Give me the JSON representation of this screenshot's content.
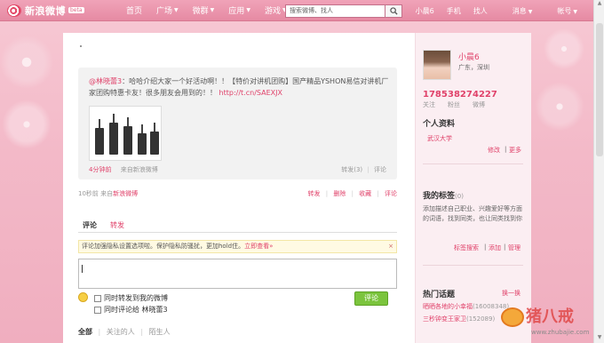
{
  "topnav": {
    "logo_text": "新浪微博",
    "logo_badge": "beta",
    "items": [
      "首页",
      "广场",
      "微群",
      "应用",
      "游戏"
    ],
    "search_placeholder": "搜索微博、找人",
    "right_items": [
      "小晨6",
      "手机",
      "找人",
      "消息",
      "帐号"
    ]
  },
  "feed": {
    "author": "@林晓蕾3",
    "text": "：哈哈介绍大家一个好活动啊！！【特价对讲机团购】国产精品YSHON易信对讲机厂家团购特惠卡友！很多朋友会用到的！！",
    "link": "http://t.cn/SAEXJX",
    "time": "4分钟前",
    "source": "来自新浪微博",
    "forward": "转发(3)",
    "comment": "评论"
  },
  "status": {
    "time": "10秒前",
    "source_prefix": "来自",
    "source": "新浪微博",
    "actions": [
      "转发",
      "删除",
      "收藏",
      "评论"
    ]
  },
  "tabs": {
    "comment": "评论",
    "forward": "转发"
  },
  "notice": {
    "text": "评论加强隐私设置选项啦。保护隐私防骚扰，更加hold住。",
    "link": "立即查看»",
    "close": "×"
  },
  "options": {
    "forward_to_mine": "同时转发到我的微博",
    "comment_to": "同时评论给 林晓蕾3",
    "submit": "评论"
  },
  "filter": {
    "all": "全部",
    "following": "关注的人",
    "strangers": "陌生人"
  },
  "profile": {
    "name": "小晨6",
    "location": "广东，深圳",
    "stats": [
      {
        "num": "1785",
        "label": "关注"
      },
      {
        "num": "3827",
        "label": "粉丝"
      },
      {
        "num": "4227",
        "label": "微博"
      }
    ],
    "section": "个人资料",
    "school": "武汉大学",
    "edit": "修改",
    "more": "更多"
  },
  "tags": {
    "title": "我的标签",
    "count": "(0)",
    "description": "添加描述自己职业、兴趣爱好等方面的词语，找到同类，也让同类找到你",
    "links": [
      "标签搜索",
      "添加",
      "管理"
    ]
  },
  "hot": {
    "title": "热门话题",
    "refresh": "换一换",
    "topics": [
      {
        "name": "晒晒各地的小幸福",
        "count": "(16008348)"
      },
      {
        "name": "三秒钟变王家卫",
        "count": "(152089)"
      }
    ]
  },
  "watermark": {
    "text": "猪八戒",
    "url": "www.zhubajie.com"
  }
}
